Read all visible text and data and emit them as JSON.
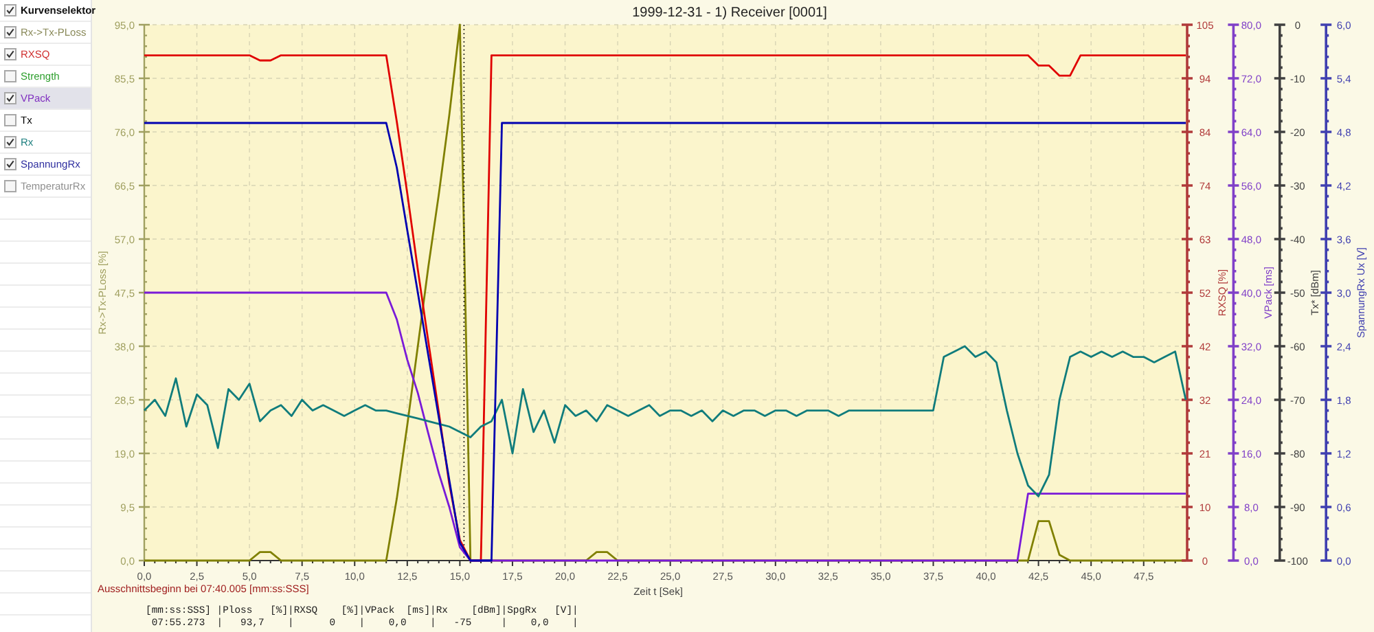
{
  "sidebar": {
    "header": {
      "label": "Kurvenselektor",
      "checked": true
    },
    "items": [
      {
        "label": "Rx->Tx-PLoss",
        "checked": true,
        "selected": false,
        "color": "#8a8a5a"
      },
      {
        "label": "RXSQ",
        "checked": true,
        "selected": false,
        "color": "#d03030"
      },
      {
        "label": "Strength",
        "checked": false,
        "selected": false,
        "color": "#30a030"
      },
      {
        "label": "VPack",
        "checked": true,
        "selected": true,
        "color": "#8030c0"
      },
      {
        "label": "Tx",
        "checked": false,
        "selected": false,
        "color": "#000000"
      },
      {
        "label": "Rx",
        "checked": true,
        "selected": false,
        "color": "#208080"
      },
      {
        "label": "SpannungRx",
        "checked": true,
        "selected": false,
        "color": "#3030a0"
      },
      {
        "label": "TemperaturRx",
        "checked": false,
        "selected": false,
        "color": "#909090"
      }
    ]
  },
  "chart": {
    "layers": [
      {
        "color": "#a0a060",
        "chart_data": {
          "type": "line",
          "grid": true,
          "title": "1999-12-31 - 1) Receiver [0001]",
          "xlabel": "Zeit  t  [Sek]",
          "ylabel": "Rx->Tx-PLoss  [%]",
          "xlim": [
            0,
            49.5
          ],
          "ylim": [
            0,
            95
          ],
          "xticks": [
            {
              "value": 0,
              "label": "0,0"
            },
            {
              "value": 2.5,
              "label": "2,5"
            },
            {
              "value": 5,
              "label": "5,0"
            },
            {
              "value": 7.5,
              "label": "7,5"
            },
            {
              "value": 10,
              "label": "10,0"
            },
            {
              "value": 12.5,
              "label": "12,5"
            },
            {
              "value": 15,
              "label": "15,0"
            },
            {
              "value": 17.5,
              "label": "17,5"
            },
            {
              "value": 20,
              "label": "20,0"
            },
            {
              "value": 22.5,
              "label": "22,5"
            },
            {
              "value": 25,
              "label": "25,0"
            },
            {
              "value": 27.5,
              "label": "27,5"
            },
            {
              "value": 30,
              "label": "30,0"
            },
            {
              "value": 32.5,
              "label": "32,5"
            },
            {
              "value": 35,
              "label": "35,0"
            },
            {
              "value": 37.5,
              "label": "37,5"
            },
            {
              "value": 40,
              "label": "40,0"
            },
            {
              "value": 42.5,
              "label": "42,5"
            },
            {
              "value": 45,
              "label": "45,0"
            },
            {
              "value": 47.5,
              "label": "47,5"
            }
          ],
          "yticks": [
            {
              "value": 0,
              "label": "0,0"
            },
            {
              "value": 9.5,
              "label": "9,5"
            },
            {
              "value": 19,
              "label": "19,0"
            },
            {
              "value": 28.5,
              "label": "28,5"
            },
            {
              "value": 38,
              "label": "38,0"
            },
            {
              "value": 47.5,
              "label": "47,5"
            },
            {
              "value": 57,
              "label": "57,0"
            },
            {
              "value": 66.5,
              "label": "66,5"
            },
            {
              "value": 76,
              "label": "76,0"
            },
            {
              "value": 85.5,
              "label": "85,5"
            },
            {
              "value": 95,
              "label": "95,0"
            }
          ],
          "x": [
            0,
            0.5,
            1,
            1.5,
            2,
            2.5,
            3,
            3.5,
            4,
            4.5,
            5,
            5.5,
            6,
            6.5,
            7,
            7.5,
            8,
            8.5,
            9,
            9.5,
            10,
            10.5,
            11,
            11.5,
            12,
            12.5,
            13,
            13.5,
            14,
            14.5,
            15,
            15.5,
            16,
            16.5,
            17,
            17.5,
            18,
            18.5,
            19,
            19.5,
            20,
            20.5,
            21,
            21.5,
            22,
            22.5,
            23,
            23.5,
            24,
            24.5,
            25,
            25.5,
            26,
            26.5,
            27,
            27.5,
            28,
            28.5,
            29,
            29.5,
            30,
            30.5,
            31,
            31.5,
            32,
            32.5,
            33,
            33.5,
            34,
            34.5,
            35,
            35.5,
            36,
            36.5,
            37,
            37.5,
            38,
            38.5,
            39,
            39.5,
            40,
            40.5,
            41,
            41.5,
            42,
            42.5,
            43,
            43.5,
            44,
            44.5,
            45,
            45.5,
            46,
            46.5,
            47,
            47.5,
            48,
            48.5,
            49,
            49.5
          ],
          "series": [
            {
              "color": "#808000",
              "values": [
                0,
                0,
                0,
                0,
                0,
                0,
                0,
                0,
                0,
                0,
                0,
                1.5,
                1.5,
                0,
                0,
                0,
                0,
                0,
                0,
                0,
                0,
                0,
                0,
                0,
                11,
                24,
                38,
                52,
                65,
                79,
                95,
                0,
                0,
                0,
                0,
                0,
                0,
                0,
                0,
                0,
                0,
                0,
                0,
                1.5,
                1.5,
                0,
                0,
                0,
                0,
                0,
                0,
                0,
                0,
                0,
                0,
                0,
                0,
                0,
                0,
                0,
                0,
                0,
                0,
                0,
                0,
                0,
                0,
                0,
                0,
                0,
                0,
                0,
                0,
                0,
                0,
                0,
                0,
                0,
                0,
                0,
                0,
                0,
                0,
                0,
                0,
                7,
                7,
                1,
                0,
                0,
                0,
                0,
                0,
                0,
                0,
                0,
                0,
                0,
                0,
                0
              ]
            }
          ]
        }
      },
      {
        "color": "#b03a3a",
        "chart_data": {
          "type": "line",
          "ylabel": "RXSQ  [%]",
          "xlim": [
            0,
            49.5
          ],
          "ylim": [
            0,
            105
          ],
          "yticks": [
            {
              "value": 0,
              "label": "0"
            },
            {
              "value": 10.5,
              "label": "10"
            },
            {
              "value": 21,
              "label": "21"
            },
            {
              "value": 31.5,
              "label": "32"
            },
            {
              "value": 42,
              "label": "42"
            },
            {
              "value": 52.5,
              "label": "52"
            },
            {
              "value": 63,
              "label": "63"
            },
            {
              "value": 73.5,
              "label": "74"
            },
            {
              "value": 84,
              "label": "84"
            },
            {
              "value": 94.5,
              "label": "94"
            },
            {
              "value": 105,
              "label": "105"
            }
          ],
          "x": [
            0,
            0.5,
            1,
            1.5,
            2,
            2.5,
            3,
            3.5,
            4,
            4.5,
            5,
            5.5,
            6,
            6.5,
            7,
            7.5,
            8,
            8.5,
            9,
            9.5,
            10,
            10.5,
            11,
            11.5,
            12,
            12.5,
            13,
            13.5,
            14,
            14.5,
            15,
            15.5,
            16,
            16.5,
            17,
            17.5,
            18,
            18.5,
            19,
            19.5,
            20,
            20.5,
            21,
            21.5,
            22,
            22.5,
            23,
            23.5,
            24,
            24.5,
            25,
            25.5,
            26,
            26.5,
            27,
            27.5,
            28,
            28.5,
            29,
            29.5,
            30,
            30.5,
            31,
            31.5,
            32,
            32.5,
            33,
            33.5,
            34,
            34.5,
            35,
            35.5,
            36,
            36.5,
            37,
            37.5,
            38,
            38.5,
            39,
            39.5,
            40,
            40.5,
            41,
            41.5,
            42,
            42.5,
            43,
            43.5,
            44,
            44.5,
            45,
            45.5,
            46,
            46.5,
            47,
            47.5,
            48,
            48.5,
            49,
            49.5
          ],
          "series": [
            {
              "color": "#e00000",
              "values": [
                99,
                99,
                99,
                99,
                99,
                99,
                99,
                99,
                99,
                99,
                99,
                98,
                98,
                99,
                99,
                99,
                99,
                99,
                99,
                99,
                99,
                99,
                99,
                99,
                86,
                72,
                57,
                43,
                29,
                15,
                4,
                0,
                0,
                99,
                99,
                99,
                99,
                99,
                99,
                99,
                99,
                99,
                99,
                99,
                99,
                99,
                99,
                99,
                99,
                99,
                99,
                99,
                99,
                99,
                99,
                99,
                99,
                99,
                99,
                99,
                99,
                99,
                99,
                99,
                99,
                99,
                99,
                99,
                99,
                99,
                99,
                99,
                99,
                99,
                99,
                99,
                99,
                99,
                99,
                99,
                99,
                99,
                99,
                99,
                99,
                97,
                97,
                95,
                95,
                99,
                99,
                99,
                99,
                99,
                99,
                99,
                99,
                99,
                99,
                99
              ]
            }
          ]
        }
      },
      {
        "color": "#8040c8",
        "chart_data": {
          "type": "line",
          "ylabel": "VPack  [ms]",
          "xlim": [
            0,
            49.5
          ],
          "ylim": [
            0,
            80
          ],
          "yticks": [
            {
              "value": 0,
              "label": "0,0"
            },
            {
              "value": 8,
              "label": "8,0"
            },
            {
              "value": 16,
              "label": "16,0"
            },
            {
              "value": 24,
              "label": "24,0"
            },
            {
              "value": 32,
              "label": "32,0"
            },
            {
              "value": 40,
              "label": "40,0"
            },
            {
              "value": 48,
              "label": "48,0"
            },
            {
              "value": 56,
              "label": "56,0"
            },
            {
              "value": 64,
              "label": "64,0"
            },
            {
              "value": 72,
              "label": "72,0"
            },
            {
              "value": 80,
              "label": "80,0"
            }
          ],
          "x": [
            0,
            0.5,
            1,
            1.5,
            2,
            2.5,
            3,
            3.5,
            4,
            4.5,
            5,
            5.5,
            6,
            6.5,
            7,
            7.5,
            8,
            8.5,
            9,
            9.5,
            10,
            10.5,
            11,
            11.5,
            12,
            12.5,
            13,
            13.5,
            14,
            14.5,
            15,
            15.5,
            16,
            16.5,
            17,
            17.5,
            18,
            18.5,
            19,
            19.5,
            20,
            20.5,
            21,
            21.5,
            22,
            22.5,
            23,
            23.5,
            24,
            24.5,
            25,
            25.5,
            26,
            26.5,
            27,
            27.5,
            28,
            28.5,
            29,
            29.5,
            30,
            30.5,
            31,
            31.5,
            32,
            32.5,
            33,
            33.5,
            34,
            34.5,
            35,
            35.5,
            36,
            36.5,
            37,
            37.5,
            38,
            38.5,
            39,
            39.5,
            40,
            40.5,
            41,
            41.5,
            42,
            42.5,
            43,
            43.5,
            44,
            44.5,
            45,
            45.5,
            46,
            46.5,
            47,
            47.5,
            48,
            48.5,
            49,
            49.5
          ],
          "series": [
            {
              "color": "#7a1ad8",
              "values": [
                40,
                40,
                40,
                40,
                40,
                40,
                40,
                40,
                40,
                40,
                40,
                40,
                40,
                40,
                40,
                40,
                40,
                40,
                40,
                40,
                40,
                40,
                40,
                40,
                36,
                30,
                25,
                19,
                13,
                8,
                2,
                0,
                0,
                0,
                0,
                0,
                0,
                0,
                0,
                0,
                0,
                0,
                0,
                0,
                0,
                0,
                0,
                0,
                0,
                0,
                0,
                0,
                0,
                0,
                0,
                0,
                0,
                0,
                0,
                0,
                0,
                0,
                0,
                0,
                0,
                0,
                0,
                0,
                0,
                0,
                0,
                0,
                0,
                0,
                0,
                0,
                0,
                0,
                0,
                0,
                0,
                0,
                0,
                0,
                10,
                10,
                10,
                10,
                10,
                10,
                10,
                10,
                10,
                10,
                10,
                10,
                10,
                10,
                10,
                10
              ]
            }
          ]
        }
      },
      {
        "color": "#404040",
        "chart_data": {
          "type": "line",
          "ylabel": "Tx*  [dBm]",
          "xlim": [
            0,
            49.5
          ],
          "ylim": [
            -100,
            0
          ],
          "yticks": [
            {
              "value": -100,
              "label": "-100"
            },
            {
              "value": -90,
              "label": "-90"
            },
            {
              "value": -80,
              "label": "-80"
            },
            {
              "value": -70,
              "label": "-70"
            },
            {
              "value": -60,
              "label": "-60"
            },
            {
              "value": -50,
              "label": "-50"
            },
            {
              "value": -40,
              "label": "-40"
            },
            {
              "value": -30,
              "label": "-30"
            },
            {
              "value": -20,
              "label": "-20"
            },
            {
              "value": -10,
              "label": "-10"
            },
            {
              "value": 0,
              "label": "0"
            }
          ],
          "x": [
            0,
            0.5,
            1,
            1.5,
            2,
            2.5,
            3,
            3.5,
            4,
            4.5,
            5,
            5.5,
            6,
            6.5,
            7,
            7.5,
            8,
            8.5,
            9,
            9.5,
            10,
            10.5,
            11,
            11.5,
            12,
            12.5,
            13,
            13.5,
            14,
            14.5,
            15,
            15.5,
            16,
            16.5,
            17,
            17.5,
            18,
            18.5,
            19,
            19.5,
            20,
            20.5,
            21,
            21.5,
            22,
            22.5,
            23,
            23.5,
            24,
            24.5,
            25,
            25.5,
            26,
            26.5,
            27,
            27.5,
            28,
            28.5,
            29,
            29.5,
            30,
            30.5,
            31,
            31.5,
            32,
            32.5,
            33,
            33.5,
            34,
            34.5,
            35,
            35.5,
            36,
            36.5,
            37,
            37.5,
            38,
            38.5,
            39,
            39.5,
            40,
            40.5,
            41,
            41.5,
            42,
            42.5,
            43,
            43.5,
            44,
            44.5,
            45,
            45.5,
            46,
            46.5,
            47,
            47.5,
            48,
            48.5,
            49,
            49.5
          ],
          "series": [
            {
              "color": "#107c7c",
              "values": [
                -72,
                -70,
                -73,
                -66,
                -75,
                -69,
                -71,
                -79,
                -68,
                -70,
                -67,
                -74,
                -72,
                -71,
                -73,
                -70,
                -72,
                -71,
                -72,
                -73,
                -72,
                -71,
                -72,
                -72,
                -72.5,
                -73,
                -73.5,
                -74,
                -74.5,
                -75,
                -76,
                -77,
                -75,
                -74,
                -70,
                -80,
                -68,
                -76,
                -72,
                -78,
                -71,
                -73,
                -72,
                -74,
                -71,
                -72,
                -73,
                -72,
                -71,
                -73,
                -72,
                -72,
                -73,
                -72,
                -74,
                -72,
                -73,
                -72,
                -72,
                -73,
                -72,
                -72,
                -73,
                -72,
                -72,
                -72,
                -73,
                -72,
                -72,
                -72,
                -72,
                -72,
                -72,
                -72,
                -72,
                -72,
                -62,
                -61,
                -60,
                -62,
                -61,
                -63,
                -72,
                -80,
                -86,
                -88,
                -84,
                -70,
                -62,
                -61,
                -62,
                -61,
                -62,
                -61,
                -62,
                -62,
                -63,
                -62,
                -61,
                -70
              ]
            }
          ]
        }
      },
      {
        "color": "#4040b0",
        "chart_data": {
          "type": "line",
          "ylabel": "SpannungRx  Ux  [V]",
          "xlim": [
            0,
            49.5
          ],
          "ylim": [
            0,
            6
          ],
          "yticks": [
            {
              "value": 0,
              "label": "0,0"
            },
            {
              "value": 0.6,
              "label": "0,6"
            },
            {
              "value": 1.2,
              "label": "1,2"
            },
            {
              "value": 1.8,
              "label": "1,8"
            },
            {
              "value": 2.4,
              "label": "2,4"
            },
            {
              "value": 3,
              "label": "3,0"
            },
            {
              "value": 3.6,
              "label": "3,6"
            },
            {
              "value": 4.2,
              "label": "4,2"
            },
            {
              "value": 4.8,
              "label": "4,8"
            },
            {
              "value": 5.4,
              "label": "5,4"
            },
            {
              "value": 6,
              "label": "6,0"
            }
          ],
          "x": [
            0,
            0.5,
            1,
            1.5,
            2,
            2.5,
            3,
            3.5,
            4,
            4.5,
            5,
            5.5,
            6,
            6.5,
            7,
            7.5,
            8,
            8.5,
            9,
            9.5,
            10,
            10.5,
            11,
            11.5,
            12,
            12.5,
            13,
            13.5,
            14,
            14.5,
            15,
            15.5,
            16,
            16.5,
            17,
            17.5,
            18,
            18.5,
            19,
            19.5,
            20,
            20.5,
            21,
            21.5,
            22,
            22.5,
            23,
            23.5,
            24,
            24.5,
            25,
            25.5,
            26,
            26.5,
            27,
            27.5,
            28,
            28.5,
            29,
            29.5,
            30,
            30.5,
            31,
            31.5,
            32,
            32.5,
            33,
            33.5,
            34,
            34.5,
            35,
            35.5,
            36,
            36.5,
            37,
            37.5,
            38,
            38.5,
            39,
            39.5,
            40,
            40.5,
            41,
            41.5,
            42,
            42.5,
            43,
            43.5,
            44,
            44.5,
            45,
            45.5,
            46,
            46.5,
            47,
            47.5,
            48,
            48.5,
            49,
            49.5
          ],
          "series": [
            {
              "color": "#0000b0",
              "values": [
                4.9,
                4.9,
                4.9,
                4.9,
                4.9,
                4.9,
                4.9,
                4.9,
                4.9,
                4.9,
                4.9,
                4.9,
                4.9,
                4.9,
                4.9,
                4.9,
                4.9,
                4.9,
                4.9,
                4.9,
                4.9,
                4.9,
                4.9,
                4.9,
                4.4,
                3.7,
                3.0,
                2.3,
                1.6,
                0.9,
                0.2,
                0,
                0,
                0,
                4.9,
                4.9,
                4.9,
                4.9,
                4.9,
                4.9,
                4.9,
                4.9,
                4.9,
                4.9,
                4.9,
                4.9,
                4.9,
                4.9,
                4.9,
                4.9,
                4.9,
                4.9,
                4.9,
                4.9,
                4.9,
                4.9,
                4.9,
                4.9,
                4.9,
                4.9,
                4.9,
                4.9,
                4.9,
                4.9,
                4.9,
                4.9,
                4.9,
                4.9,
                4.9,
                4.9,
                4.9,
                4.9,
                4.9,
                4.9,
                4.9,
                4.9,
                4.9,
                4.9,
                4.9,
                4.9,
                4.9,
                4.9,
                4.9,
                4.9,
                4.9,
                4.9,
                4.9,
                4.9,
                4.9,
                4.9,
                4.9,
                4.9,
                4.9,
                4.9,
                4.9,
                4.9,
                4.9,
                4.9,
                4.9,
                4.9
              ]
            }
          ]
        }
      }
    ]
  },
  "cursor_readout": {
    "note": "Ausschnittsbeginn bei 07:40.005 [mm:ss:SSS]",
    "header": "[mm:ss:SSS] |Ploss   [%]|RXSQ    [%]|VPack  [ms]|Rx    [dBm]|SpgRx   [V]|",
    "row": " 07:55.273  |   93,7    |      0    |    0,0    |   -75     |    0,0    |"
  }
}
